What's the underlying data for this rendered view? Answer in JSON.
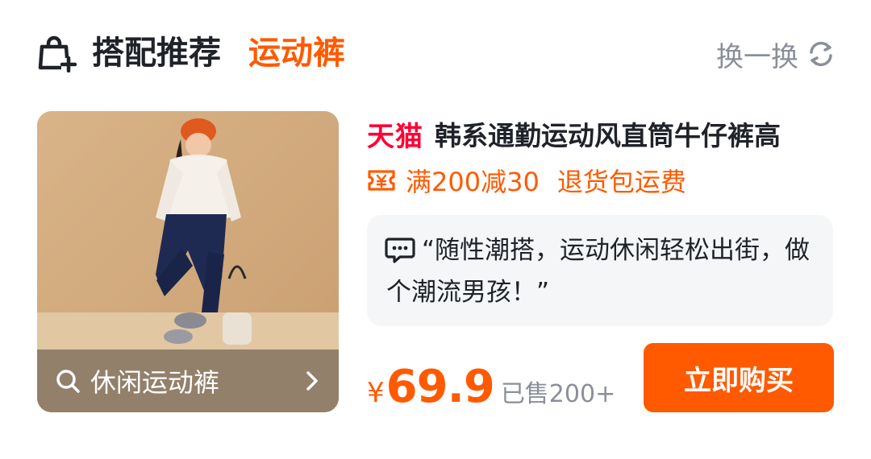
{
  "header": {
    "title": "搭配推荐",
    "tag": "运动裤",
    "refresh_label": "换一换"
  },
  "product_image": {
    "search_label": "休闲运动裤"
  },
  "product": {
    "store_logo": "天猫",
    "title": "韩系通勤运动风直筒牛仔裤高",
    "promo": "满200减30",
    "promo_extra": "退货包运费",
    "quote": "“随性潮搭，运动休闲轻松出街，做个潮流男孩！”",
    "currency": "¥",
    "price": "69.9",
    "sold": "已售200+",
    "buy_label": "立即购买"
  },
  "colors": {
    "accent": "#ff5a00",
    "tmall_red": "#ff0036",
    "muted": "#8a8f99",
    "quote_bg": "#f4f6f8"
  },
  "icons": {
    "header": "shopping-bag-plus-icon",
    "refresh": "refresh-icon",
    "search": "search-icon",
    "chevron": "chevron-right-icon",
    "coupon": "coupon-icon",
    "quote": "chat-bubble-icon"
  }
}
